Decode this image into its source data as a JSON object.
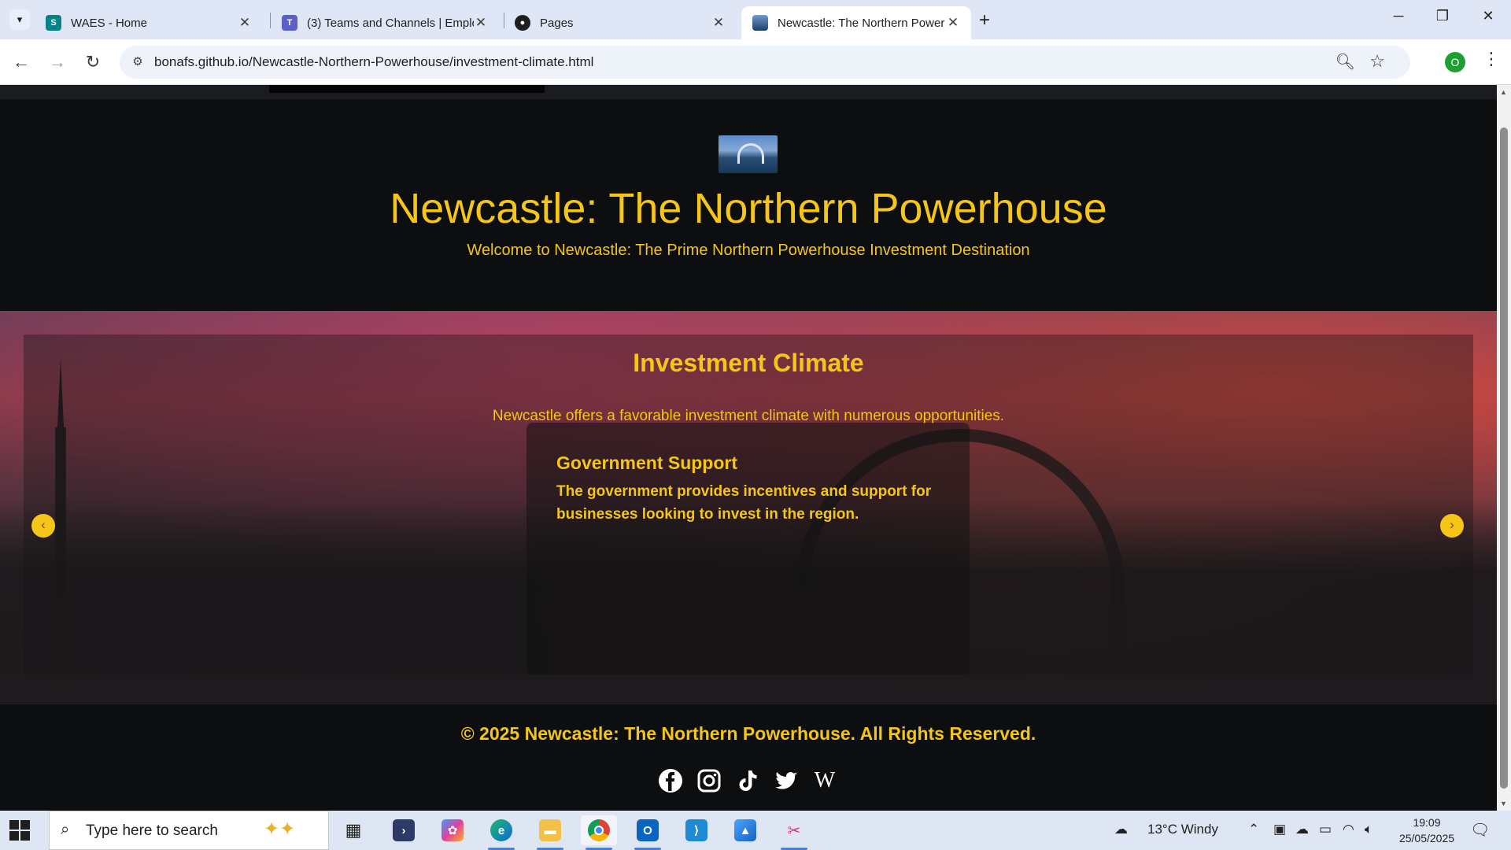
{
  "browser": {
    "tabs": [
      {
        "title": "WAES - Home",
        "icon": "sharepoint-icon",
        "color": "#038387"
      },
      {
        "title": "(3) Teams and Channels | Emplo",
        "icon": "teams-icon",
        "color": "#5b5fc7"
      },
      {
        "title": "Pages",
        "icon": "github-icon",
        "color": "#1f1f1f"
      },
      {
        "title": "Newcastle: The Northern Power",
        "icon": "site-favicon",
        "color": "#3b6ea5"
      }
    ],
    "url": "bonafs.github.io/Newcastle-Northern-Powerhouse/investment-climate.html",
    "profile_initial": "O"
  },
  "page": {
    "title": "Newcastle: The Northern Powerhouse",
    "tagline": "Welcome to Newcastle: The Prime Northern Powerhouse Investment Destination",
    "section_title": "Investment Climate",
    "section_intro": "Newcastle offers a favorable investment climate with numerous opportunities.",
    "card": {
      "title": "Government Support",
      "text": "The government provides incentives and support for businesses looking to invest in the region."
    },
    "footer": "© 2025 Newcastle: The Northern Powerhouse. All Rights Reserved.",
    "social": [
      "facebook-icon",
      "instagram-icon",
      "tiktok-icon",
      "twitter-icon",
      "wikipedia-icon"
    ],
    "accent_color": "#f5c518"
  },
  "taskbar": {
    "search_placeholder": "Type here to search",
    "weather": "13°C  Windy",
    "time": "19:09",
    "date": "25/05/2025",
    "apps": [
      "powershell-icon",
      "copilot-icon",
      "edge-icon",
      "file-explorer-icon",
      "chrome-icon",
      "outlook-icon",
      "vscode-icon",
      "photos-icon",
      "snipping-tool-icon"
    ]
  }
}
